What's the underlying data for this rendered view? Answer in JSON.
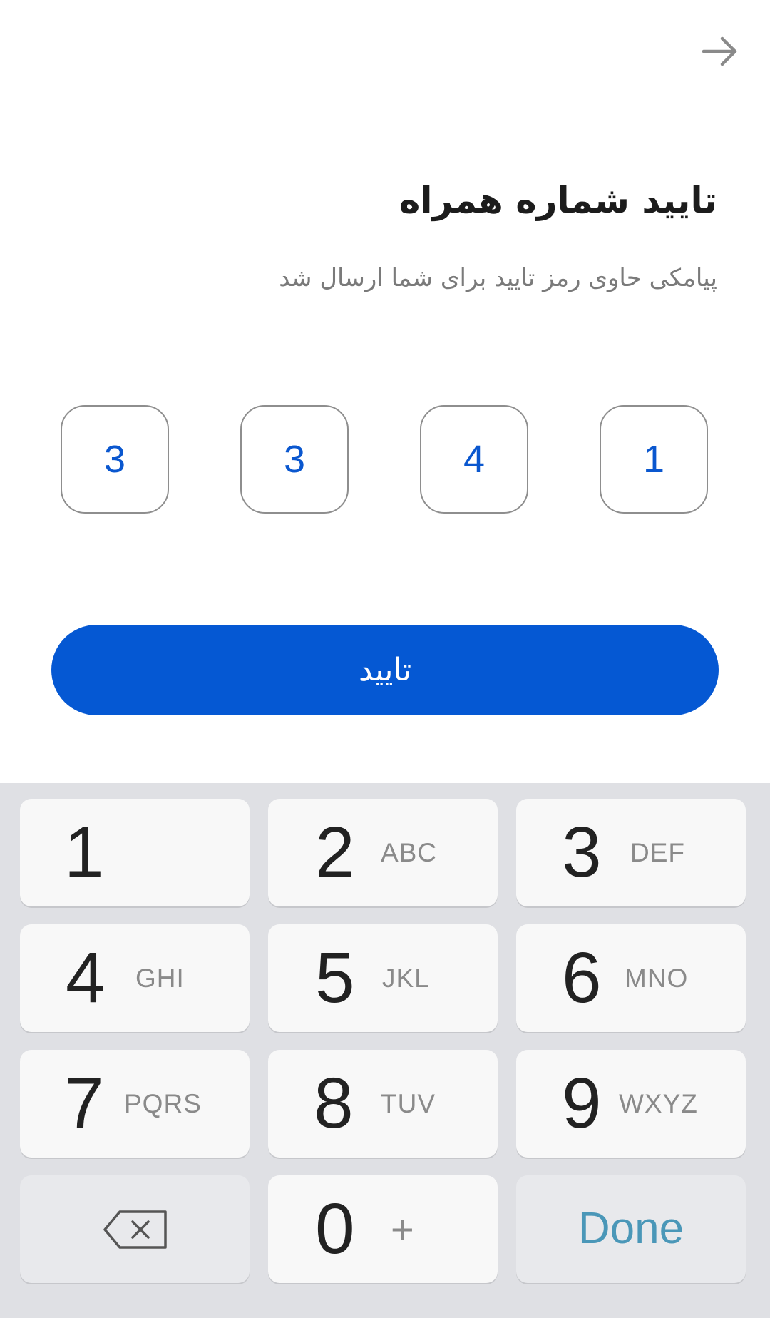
{
  "header": {
    "back_icon": "arrow-right-icon"
  },
  "title": "تایید شماره همراه",
  "subtitle": "پیامکی حاوی رمز تایید برای شما ارسال شد",
  "otp": {
    "digits": [
      "3",
      "3",
      "4",
      "1"
    ]
  },
  "confirm_button": {
    "label": "تایید",
    "color": "#0558d3"
  },
  "keyboard": {
    "keys": [
      {
        "num": "1",
        "letters": ""
      },
      {
        "num": "2",
        "letters": "ABC"
      },
      {
        "num": "3",
        "letters": "DEF"
      },
      {
        "num": "4",
        "letters": "GHI"
      },
      {
        "num": "5",
        "letters": "JKL"
      },
      {
        "num": "6",
        "letters": "MNO"
      },
      {
        "num": "7",
        "letters": "PQRS"
      },
      {
        "num": "8",
        "letters": "TUV"
      },
      {
        "num": "9",
        "letters": "WXYZ"
      }
    ],
    "zero": {
      "num": "0",
      "extra": "+"
    },
    "done_label": "Done",
    "backspace_icon": "backspace-icon",
    "done_color": "#4a97b8"
  },
  "colors": {
    "accent": "#0558d3",
    "otp_digit": "#0a57cf",
    "keyboard_bg": "#dfe0e4"
  }
}
